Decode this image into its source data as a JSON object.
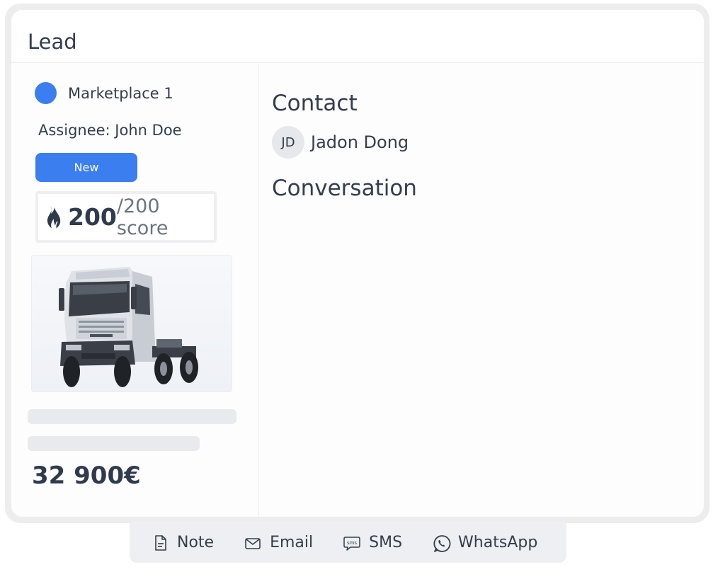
{
  "card": {
    "title": "Lead"
  },
  "lead": {
    "marketplace": "Marketplace 1",
    "marketplace_color": "#3a7ef0",
    "assignee": "Assignee: John Doe",
    "status": "New",
    "status_color": "#3a7ef0",
    "score": {
      "value": "200",
      "total": "/200 score",
      "icon": "flame-icon"
    },
    "vehicle_image": "truck-image",
    "price": "32 900€"
  },
  "contact": {
    "heading": "Contact",
    "avatar_initials": "JD",
    "name": "Jadon Dong"
  },
  "conversation": {
    "heading": "Conversation"
  },
  "actions": [
    {
      "label": "Note",
      "icon": "note-icon"
    },
    {
      "label": "Email",
      "icon": "email-icon"
    },
    {
      "label": "SMS",
      "icon": "sms-icon"
    },
    {
      "label": "WhatsApp",
      "icon": "whatsapp-icon"
    }
  ]
}
